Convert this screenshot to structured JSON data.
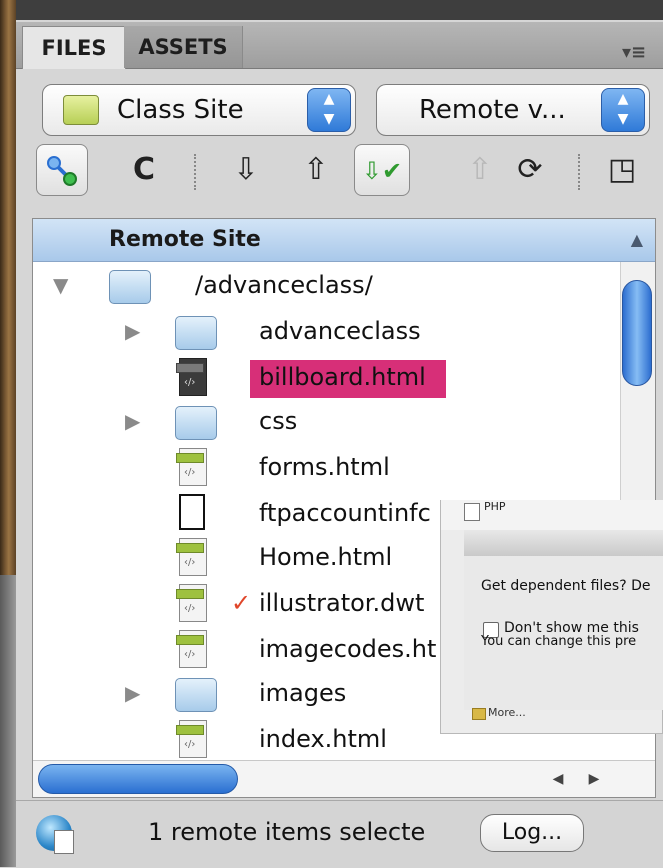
{
  "tabs": {
    "files": "FILES",
    "assets": "ASSETS",
    "menu_icon": "panel-menu-icon",
    "menu_glyph": "▾≡"
  },
  "selectors": {
    "site": "Class Site",
    "view": "Remote v..."
  },
  "toolbar": {
    "connect_icon": "connect-icon",
    "refresh_glyph": "C",
    "get_glyph": "⇩",
    "put_glyph": "⇧",
    "checkout_glyph": "⇩✔",
    "checkin_glyph": "⇧",
    "sync_glyph": "⟳",
    "expand_glyph": "◳"
  },
  "file_list": {
    "header": "Remote Site",
    "root": "/advanceclass/",
    "items": [
      {
        "name": "advanceclass",
        "type": "folder"
      },
      {
        "name": "billboard.html",
        "type": "html-selected"
      },
      {
        "name": "css",
        "type": "folder"
      },
      {
        "name": "forms.html",
        "type": "html"
      },
      {
        "name": "ftpaccountinfc",
        "type": "doc"
      },
      {
        "name": "Home.html",
        "type": "html"
      },
      {
        "name": "illustrator.dwt",
        "type": "html",
        "mark": "✓"
      },
      {
        "name": "imagecodes.ht",
        "type": "html"
      },
      {
        "name": "images",
        "type": "folder"
      },
      {
        "name": "index.html",
        "type": "html"
      }
    ]
  },
  "dialog": {
    "php_label": "PHP",
    "line1": "Get dependent files? De",
    "checkbox_label": "Don't show me this",
    "line3": "You can change this pre",
    "more_label": "More..."
  },
  "status": {
    "text": "1 remote items selecte",
    "log_button": "Log..."
  },
  "colors": {
    "selected_highlight": "#d72f78",
    "scroll_accent": "#2a6fd1",
    "header_blue": "#a9c8ea"
  }
}
